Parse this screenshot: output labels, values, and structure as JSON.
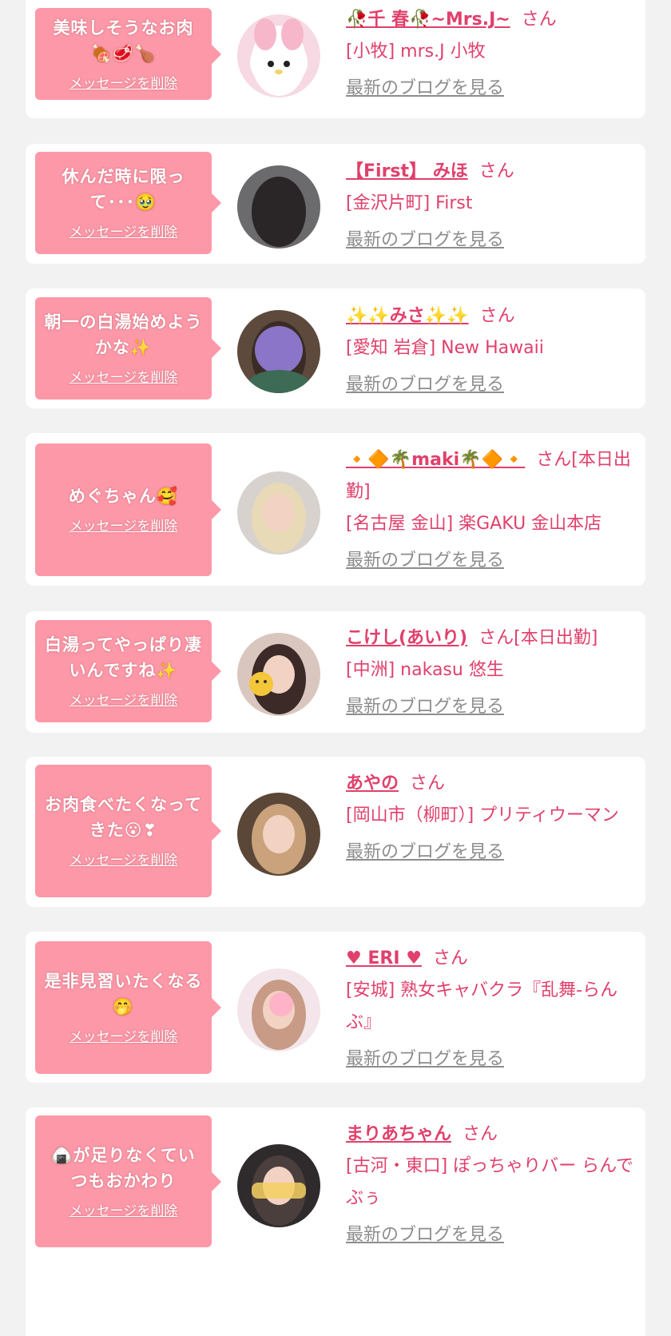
{
  "delete_label": "メッセージを削除",
  "blog_label": "最新のブログを見る",
  "san_label": "さん",
  "accent_color": "#e0406b",
  "bubble_color": "#fd98a8",
  "cards": [
    {
      "message": "美味しそうなお肉🍖🥩🍗",
      "name": "🥀千 春🥀~Mrs.J~",
      "suffix": "さん",
      "shop": "[小牧] mrs.J 小牧",
      "avatar_icon": "pink-bunny-avatar-icon"
    },
    {
      "message": "休んだ時に限って･･･🥹",
      "name": "【First】 みほ",
      "suffix": "さん",
      "shop": "[金沢片町] First",
      "avatar_icon": "woman-back-hair-avatar-icon"
    },
    {
      "message": "朝一の白湯始めようかな✨",
      "name": "✨✨みさ✨✨",
      "suffix": "さん",
      "shop": "[愛知 岩倉] New Hawaii",
      "avatar_icon": "woman-purple-mosaic-avatar-icon"
    },
    {
      "message": "めぐちゃん🥰",
      "name": "🔸🔶🌴maki🌴🔶🔸",
      "suffix": "さん[本日出勤]",
      "shop": "[名古屋 金山] 楽GAKU 金山本店",
      "avatar_icon": "blonde-woman-avatar-icon"
    },
    {
      "message": "白湯ってやっぱり凄いんですね✨",
      "name": "こけし(あいり)",
      "suffix": "さん[本日出勤]",
      "shop": "[中洲] nakasu 悠生",
      "avatar_icon": "woman-emoji-face-avatar-icon"
    },
    {
      "message": "お肉食べたくなってきた😮❣",
      "name": "あやの",
      "suffix": "さん",
      "shop": "[岡山市（柳町）] プリティウーマン",
      "avatar_icon": "woman-hair-clip-avatar-icon"
    },
    {
      "message": "是非見習いたくなる🤭",
      "name": "♥ ERI ♥",
      "suffix": "さん",
      "shop": "[安城] 熟女キャバクラ『乱舞-らんぶ』",
      "avatar_icon": "woman-heart-face-avatar-icon"
    },
    {
      "message": "🍙が足りなくていつもおかわり",
      "name": "まりあちゃん",
      "suffix": "さん",
      "shop": "[古河・東口] ぽっちゃりバー らんでぶぅ",
      "avatar_icon": "woman-happy-glasses-avatar-icon"
    }
  ]
}
